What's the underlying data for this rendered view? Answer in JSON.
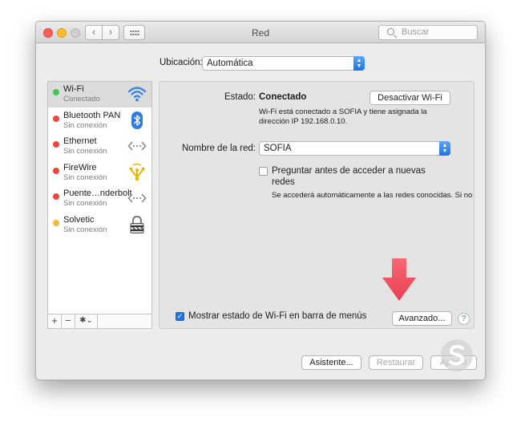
{
  "window": {
    "title": "Red",
    "search_placeholder": "Buscar",
    "nav_back": "‹",
    "nav_forward": "›"
  },
  "location": {
    "label": "Ubicación:",
    "value": "Automática"
  },
  "services": [
    {
      "name": "Wi-Fi",
      "status": "Conectado",
      "dot_color": "#3fc950",
      "icon": "wifi-icon",
      "selected": true
    },
    {
      "name": "Bluetooth PAN",
      "status": "Sin conexión",
      "dot_color": "#f1453d",
      "icon": "bluetooth-icon",
      "selected": false
    },
    {
      "name": "Ethernet",
      "status": "Sin conexión",
      "dot_color": "#f1453d",
      "icon": "ethernet-icon",
      "selected": false
    },
    {
      "name": "FireWire",
      "status": "Sin conexión",
      "dot_color": "#f1453d",
      "icon": "firewire-icon",
      "selected": false
    },
    {
      "name": "Puente…nderbolt",
      "status": "Sin conexión",
      "dot_color": "#f1453d",
      "icon": "thunderbolt-bridge-icon",
      "selected": false
    },
    {
      "name": "Solvetic",
      "status": "Sin conexión",
      "dot_color": "#f5b73b",
      "icon": "lock-icon",
      "selected": false
    }
  ],
  "sidebar_toolbar": {
    "add": "+",
    "remove": "−",
    "gear": "✱⌄"
  },
  "detail": {
    "status_label": "Estado:",
    "status_value": "Conectado",
    "toggle_button": "Desactivar Wi-Fi",
    "status_desc_1": "Wi-Fi está conectado a SOFIA y tiene asignada la",
    "status_desc_2": "dirección IP 192.168.0.10.",
    "network_label": "Nombre de la red:",
    "network_value": "SOFIA",
    "ask_label_1": "Preguntar antes de acceder a nuevas",
    "ask_label_2": "redes",
    "ask_desc": "Se accederá automáticamente a las redes conocidas. Si no",
    "show_status_label": "Mostrar estado de Wi-Fi en barra de menús",
    "advanced_button": "Avanzado...",
    "help": "?"
  },
  "footer": {
    "assistant_button": "Asistente...",
    "revert_button": "Restaurar",
    "apply_button": "Aplicar"
  },
  "colors": {
    "accent": "#1f75e8",
    "arrow": "#f0525f"
  }
}
